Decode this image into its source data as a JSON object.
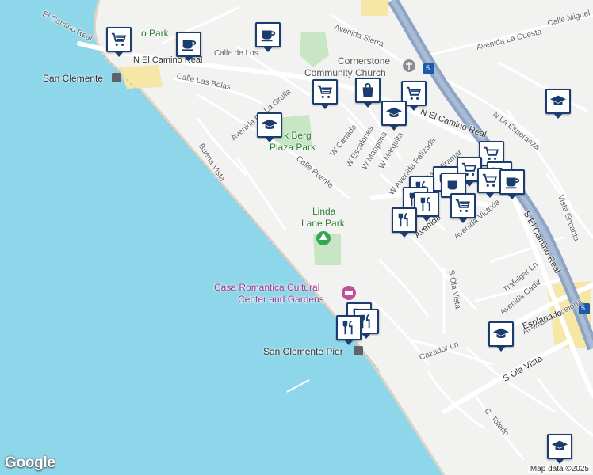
{
  "map": {
    "labels": {
      "n_el_camino_real": "N El Camino Real",
      "el_camino_real_nw": "El Camino Real",
      "avenida_sierra": "Avenida Sierra",
      "avenida_la_cuesta": "Avenida La Cuesta",
      "calle_miguel": "Calle Miguel",
      "calle_de_los": "Calle de Los",
      "calle_las_bolas": "Calle Las Bolas",
      "avenida_de_la_grulla": "Avenida De La Grulla",
      "w_canada": "W Canada",
      "w_escalones": "W Escalones",
      "w_mariposa": "W Mariposa",
      "w_marquita": "W Marquita",
      "n_la_esperanza": "N La Esperanza",
      "w_avenida_palizada": "W Avenida Palizada",
      "avenida_miramar": "Avenida Miramar",
      "calle_puente": "Calle Puente",
      "buena_vista": "Buena Vista",
      "s_el_camino_real": "S El Camino Real",
      "vista_encanta": "Vista Encanta",
      "avenida_victoria": "Avenida Victoria",
      "trafalgar_ln": "Trafalgar Ln",
      "avenida_cadiz": "Avenida Cadiz",
      "avenida_barcelona": "Avenida Barcelona",
      "esplanade": "Esplanade",
      "s_ola_vista_n": "S Ola Vista",
      "s_ola_vista_s": "S Ola Vista",
      "cazador_ln": "Cazador Ln",
      "c_toledo": "C. Toledo",
      "avenida_del_mar": "Avenida",
      "highway_5": "5"
    },
    "places": {
      "san_clemente": "San Clemente",
      "park_nw": "o Park",
      "cornerstone": "Cornerstone",
      "community_church": "Community Church",
      "berg_plaza_line1": "k Berg",
      "berg_plaza_line2": "Plaza Park",
      "linda_lane_line1": "Linda",
      "linda_lane_line2": "Lane Park",
      "casa_line1": "Casa Romantica Cultural",
      "casa_line2": "Center and Gardens",
      "san_clemente_pier": "San Clemente Pier"
    },
    "logo": "Google",
    "attribution": "Map data ©2025"
  },
  "pins": [
    {
      "name": "shopping-pin",
      "icon": "cart-icon"
    },
    {
      "name": "cafe-pin",
      "icon": "coffee-cup-icon"
    },
    {
      "name": "cafe-pin",
      "icon": "coffee-cup-icon"
    },
    {
      "name": "shopping-pin",
      "icon": "cart-icon"
    },
    {
      "name": "store-pin",
      "icon": "shopping-bag-icon"
    },
    {
      "name": "shopping-pin",
      "icon": "cart-icon"
    },
    {
      "name": "school-pin",
      "icon": "graduation-cap-icon"
    },
    {
      "name": "school-pin",
      "icon": "graduation-cap-icon"
    },
    {
      "name": "school-pin",
      "icon": "graduation-cap-icon"
    },
    {
      "name": "shopping-pin",
      "icon": "cart-icon"
    },
    {
      "name": "cafe-pin",
      "icon": "coffee-cup-icon"
    },
    {
      "name": "restaurant-pin",
      "icon": "fork-knife-icon"
    },
    {
      "name": "shopping-pin",
      "icon": "cart-icon"
    },
    {
      "name": "restaurant-pin",
      "icon": "fork-knife-icon"
    },
    {
      "name": "school-pin",
      "icon": "graduation-cap-icon"
    },
    {
      "name": "school-pin",
      "icon": "graduation-cap-icon"
    }
  ],
  "colors": {
    "water": "#8ed6ea",
    "land": "#f2f2f0",
    "highway": "#8da4c4",
    "road": "#ffffff",
    "park": "#c8e6c3",
    "pin_border": "#1a3c6e"
  }
}
